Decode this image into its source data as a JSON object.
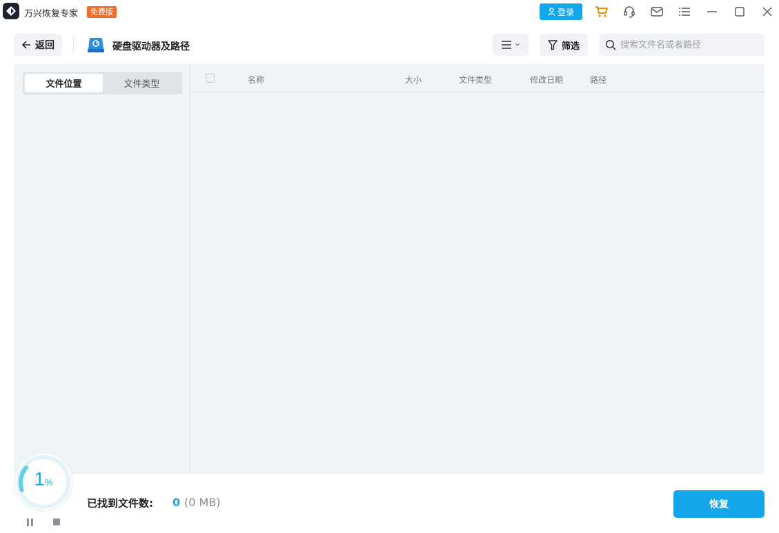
{
  "app": {
    "title": "万兴恢复专家",
    "badge": "免费版",
    "login_label": "登录"
  },
  "toolbar": {
    "back_label": "返回",
    "location_title": "硬盘驱动器及路径",
    "filter_label": "筛选",
    "search_placeholder": "搜索文件名或者路径"
  },
  "sidebar": {
    "tabs": [
      {
        "label": "文件位置",
        "active": true
      },
      {
        "label": "文件类型",
        "active": false
      }
    ]
  },
  "table": {
    "columns": [
      "名称",
      "大小",
      "文件类型",
      "修改日期",
      "路径"
    ],
    "rows": []
  },
  "scan": {
    "progress_value": "1",
    "progress_unit": "%",
    "found_label": "已找到文件数:",
    "found_count": "0",
    "found_size": "(0 MB)"
  },
  "footer": {
    "recover_label": "恢复"
  },
  "colors": {
    "accent": "#13a6ea",
    "badge": "#f36d2a",
    "cart": "#f08a00",
    "panel_bg": "#f0f3f6"
  }
}
